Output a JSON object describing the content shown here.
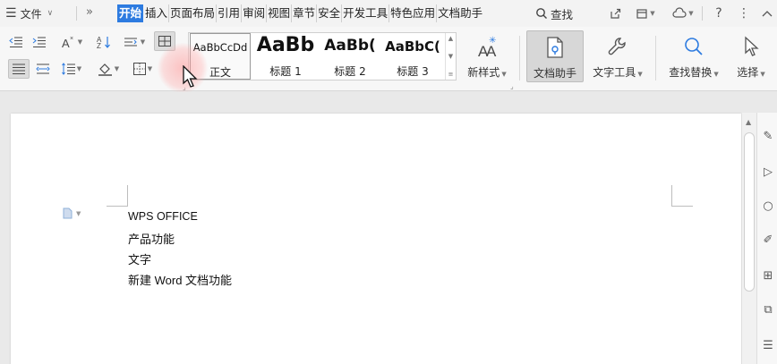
{
  "menubar": {
    "file_label": "文件",
    "tabs": [
      "开始",
      "插入",
      "页面布局",
      "引用",
      "审阅",
      "视图",
      "章节",
      "安全",
      "开发工具",
      "特色应用",
      "文档助手"
    ],
    "active_tab": "开始",
    "search_label": "查找"
  },
  "ribbon": {
    "styles": [
      {
        "preview": "AaBbCcDd",
        "caption": "正文"
      },
      {
        "preview": "AaBb",
        "caption": "标题 1"
      },
      {
        "preview": "AaBb(",
        "caption": "标题 2"
      },
      {
        "preview": "AaBbC(",
        "caption": "标题 3"
      }
    ],
    "new_style_label": "新样式",
    "doc_assistant_label": "文档助手",
    "text_tools_label": "文字工具",
    "find_replace_label": "查找替换",
    "select_label": "选择"
  },
  "document": {
    "lines": [
      "WPS OFFICE",
      "产品功能",
      "文字",
      "新建 Word 文档功能"
    ]
  },
  "colors": {
    "accent": "#2d7be0",
    "menubar_bg": "#f3f3f3",
    "ribbon_bg": "#f7f7f7",
    "workspace_bg": "#e9e9e9"
  }
}
